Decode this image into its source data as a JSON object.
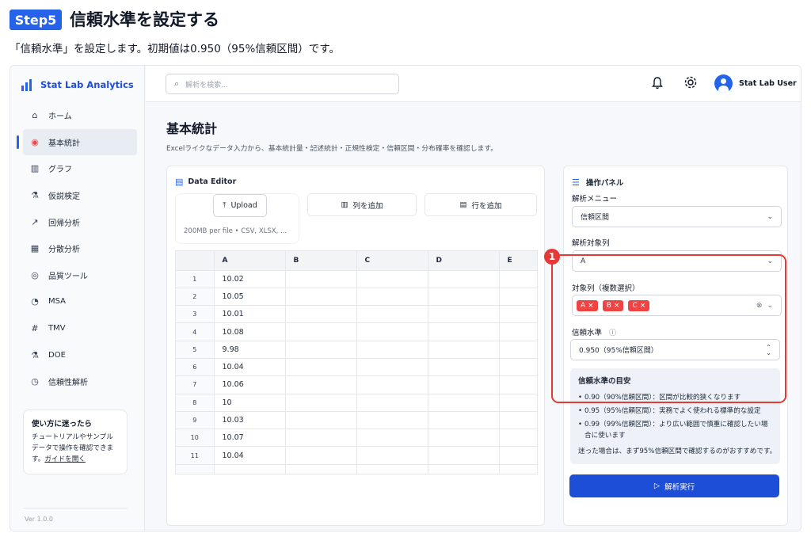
{
  "step": {
    "badge": "Step5",
    "title": "信頼水準を設定する",
    "description": "「信頼水準」を設定します。初期値は0.950（95%信頼区間）です。"
  },
  "app": {
    "brand": "Stat Lab Analytics",
    "version": "Ver 1.0.0",
    "nav": [
      {
        "label": "ホーム",
        "icon": "home-icon"
      },
      {
        "label": "基本統計",
        "icon": "target-icon"
      },
      {
        "label": "グラフ",
        "icon": "bar-chart-icon"
      },
      {
        "label": "仮説検定",
        "icon": "flask-icon"
      },
      {
        "label": "回帰分析",
        "icon": "trend-icon"
      },
      {
        "label": "分散分析",
        "icon": "grid-icon"
      },
      {
        "label": "品質ツール",
        "icon": "gauge-icon"
      },
      {
        "label": "MSA",
        "icon": "meter-icon"
      },
      {
        "label": "TMV",
        "icon": "hash-icon"
      },
      {
        "label": "DOE",
        "icon": "beaker-icon"
      },
      {
        "label": "信頼性解析",
        "icon": "clock-icon"
      }
    ],
    "help": {
      "title": "使い方に迷ったら",
      "text": "チュートリアルやサンプルデータで操作を確認できます。",
      "link": "ガイドを開く"
    },
    "search_placeholder": "解析を検索...",
    "user": "Stat Lab User",
    "page": {
      "title": "基本統計",
      "subtitle": "Excelライクなデータ入力から、基本統計量・記述統計・正規性検定・信頼区間・分布確率を確認します。"
    },
    "editor": {
      "title": "Data Editor",
      "upload": "Upload",
      "upload_hint": "200MB per file • CSV, XLSX, ...",
      "add_column": "列を追加",
      "add_row": "行を追加",
      "columns": [
        "A",
        "B",
        "C",
        "D",
        "E"
      ],
      "rows": [
        [
          "1",
          "10.02"
        ],
        [
          "2",
          "10.05"
        ],
        [
          "3",
          "10.01"
        ],
        [
          "4",
          "10.08"
        ],
        [
          "5",
          "9.98"
        ],
        [
          "6",
          "10.04"
        ],
        [
          "7",
          "10.06"
        ],
        [
          "8",
          "10"
        ],
        [
          "9",
          "10.03"
        ],
        [
          "10",
          "10.07"
        ],
        [
          "11",
          "10.04"
        ]
      ]
    },
    "panel": {
      "title": "操作パネル",
      "menu_label": "解析メニュー",
      "menu_value": "信頼区間",
      "target_label": "解析対象列",
      "target_value": "A",
      "multi_label": "対象列（複数選択）",
      "tags": [
        "A",
        "B",
        "C"
      ],
      "confidence_label": "信頼水準",
      "confidence_value": "0.950（95%信頼区間）",
      "guide_title": "信頼水準の目安",
      "guide_items": [
        "0.90（90%信頼区間）：区間が比較的狭くなります",
        "0.95（95%信頼区間）：実務でよく使われる標準的な設定",
        "0.99（99%信頼区間）：より広い範囲で慎重に確認したい場合に使います"
      ],
      "guide_note": "迷った場合は、まず95%信頼区間で確認するのがおすすめです。",
      "run": "解析実行",
      "marker": "1"
    }
  }
}
